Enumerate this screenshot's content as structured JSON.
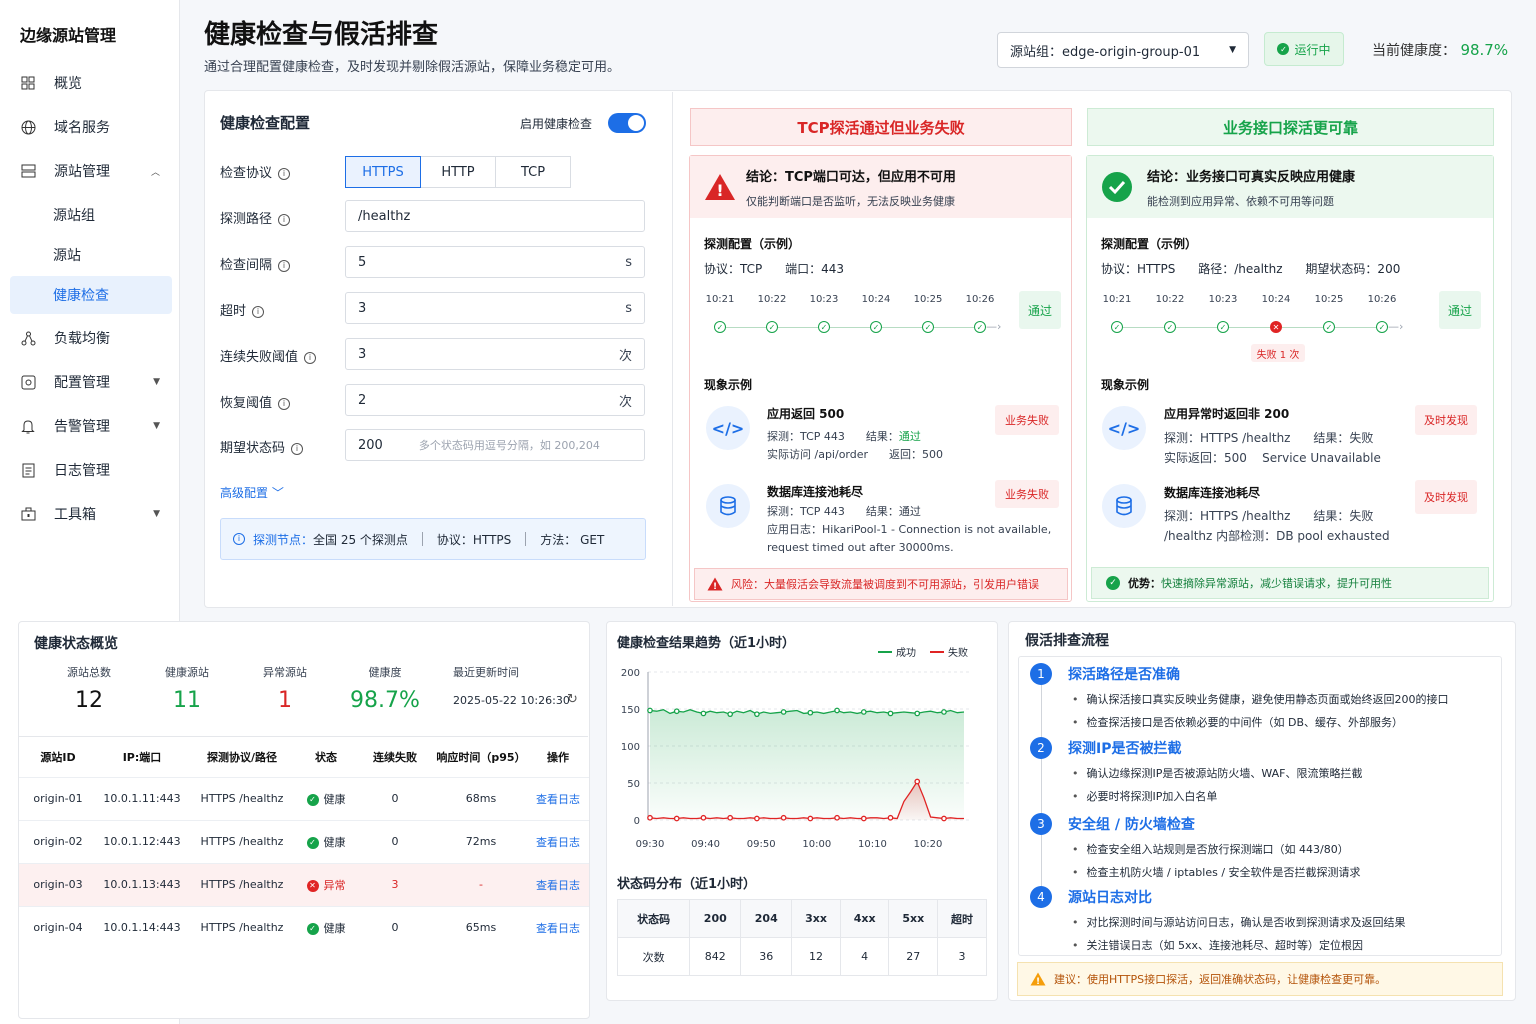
{
  "sidebar": {
    "brand": "边缘源站管理",
    "items": [
      {
        "label": "概览",
        "icon": "grid-icon"
      },
      {
        "label": "域名服务",
        "icon": "globe-icon"
      },
      {
        "label": "源站管理",
        "icon": "server-icon"
      },
      {
        "label": "源站组"
      },
      {
        "label": "源站"
      },
      {
        "label": "健康检查"
      },
      {
        "label": "负载均衡",
        "icon": "share-icon"
      },
      {
        "label": "配置管理",
        "icon": "settings-icon"
      },
      {
        "label": "告警管理",
        "icon": "bell-icon"
      },
      {
        "label": "日志管理",
        "icon": "doc-icon"
      },
      {
        "label": "工具箱",
        "icon": "toolbox-icon"
      }
    ]
  },
  "header": {
    "title": "健康检查与假活排查",
    "subtitle": "通过合理配置健康检查，及时发现并剔除假活源站，保障业务稳定可用。",
    "group_label": "源站组：edge-origin-group-01",
    "status": "运行中",
    "health_label": "当前健康度：",
    "health_value": "98.7%"
  },
  "config": {
    "title": "健康检查配置",
    "enable_label": "启用健康检查",
    "protocol_label": "检查协议",
    "protocols": [
      "HTTPS",
      "HTTP",
      "TCP"
    ],
    "path_label": "探测路径",
    "path": "/healthz",
    "interval_label": "检查间隔",
    "interval": "5",
    "interval_unit": "s",
    "timeout_label": "超时",
    "timeout": "3",
    "timeout_unit": "s",
    "fail_label": "连续失败阈值",
    "fail": "3",
    "fail_unit": "次",
    "recover_label": "恢复阈值",
    "recover": "2",
    "recover_unit": "次",
    "code_label": "期望状态码",
    "code": "200",
    "code_hint": "多个状态码用逗号分隔，如 200,204",
    "advanced": "高级配置",
    "probe_node_label": "探测节点：",
    "probe_nodes": "全国 25 个探测点",
    "probe_proto": "协议：HTTPS",
    "probe_method": "方法：  GET"
  },
  "tcp_card": {
    "title": "TCP探活通过但业务失败",
    "concl": "结论：TCP端口可达，但应用不可用",
    "concl_sub": "仅能判断端口是否监听，无法反映业务健康",
    "probe_title": "探测配置（示例）",
    "probe_line": "协议：TCP      端口：443",
    "times": [
      "10:21",
      "10:22",
      "10:23",
      "10:24",
      "10:25",
      "10:26"
    ],
    "pass": "通过",
    "ex_title": "现象示例",
    "ex1_t": "应用返回 500",
    "ex1_d1a": "探测：TCP 443      结果：",
    "ex1_d1b": "通过",
    "ex1_d2": "实际访问 /api/order      返回：500",
    "ex1_tag": "业务失败",
    "ex2_t": "数据库连接池耗尽",
    "ex2_d1": "探测：TCP 443      结果：通过",
    "ex2_d2": "应用日志：HikariPool-1 - Connection is not available,",
    "ex2_d3": "request timed out after 30000ms.",
    "ex2_tag": "业务失败",
    "risk": "风险：大量假活会导致流量被调度到不可用源站，引发用户错误"
  },
  "http_card": {
    "title": "业务接口探活更可靠",
    "concl": "结论：业务接口可真实反映应用健康",
    "concl_sub": "能检测到应用异常、依赖不可用等问题",
    "probe_title": "探测配置（示例）",
    "probe_line": "协议：HTTPS      路径：/healthz      期望状态码：200",
    "times": [
      "10:21",
      "10:22",
      "10:23",
      "10:24",
      "10:25",
      "10:26"
    ],
    "pass": "通过",
    "fail_tag": "失败 1 次",
    "ex_title": "现象示例",
    "ex1_t": "应用异常时返回非 200",
    "ex1_d1": "探测：HTTPS /healthz      结果：失败",
    "ex1_d2": "实际返回：500    Service Unavailable",
    "ex1_tag": "及时发现",
    "ex2_t": "数据库连接池耗尽",
    "ex2_d1": "探测：HTTPS /healthz      结果：失败",
    "ex2_d2": "/healthz 内部检测：DB pool exhausted",
    "ex2_tag": "及时发现",
    "adv_label": "优势：",
    "adv": "快速摘除异常源站，减少错误请求，提升可用性"
  },
  "overview": {
    "title": "健康状态概览",
    "stats": [
      {
        "label": "源站总数",
        "value": "12",
        "color": "#111111"
      },
      {
        "label": "健康源站",
        "value": "11",
        "color": "#16a34a"
      },
      {
        "label": "异常源站",
        "value": "1",
        "color": "#d92626"
      },
      {
        "label": "健康度",
        "value": "98.7%",
        "color": "#16a34a"
      }
    ],
    "updated_label": "最近更新时间",
    "updated": "2025-05-22 10:26:30",
    "columns": [
      "源站ID",
      "IP:端口",
      "探测协议/路径",
      "状态",
      "连续失败",
      "响应时间（p95）",
      "操作"
    ],
    "rows": [
      {
        "id": "origin-01",
        "ip": "10.0.1.11:443",
        "probe": "HTTPS /healthz",
        "status": "健康",
        "fails": "0",
        "rt": "68ms",
        "op": "查看日志",
        "bad": false
      },
      {
        "id": "origin-02",
        "ip": "10.0.1.12:443",
        "probe": "HTTPS /healthz",
        "status": "健康",
        "fails": "0",
        "rt": "72ms",
        "op": "查看日志",
        "bad": false
      },
      {
        "id": "origin-03",
        "ip": "10.0.1.13:443",
        "probe": "HTTPS /healthz",
        "status": "异常",
        "fails": "3",
        "rt": "-",
        "op": "查看日志",
        "bad": true
      },
      {
        "id": "origin-04",
        "ip": "10.0.1.14:443",
        "probe": "HTTPS /healthz",
        "status": "健康",
        "fails": "0",
        "rt": "65ms",
        "op": "查看日志",
        "bad": false
      }
    ]
  },
  "chart_data": {
    "type": "line",
    "title": "健康检查结果趋势（近1小时）",
    "x": [
      "09:30",
      "09:35",
      "09:40",
      "09:45",
      "09:50",
      "09:55",
      "10:00",
      "10:05",
      "10:10",
      "10:15",
      "10:20",
      "10:25"
    ],
    "x_ticks": [
      "09:30",
      "09:40",
      "09:50",
      "10:00",
      "10:10",
      "10:20"
    ],
    "ylim": [
      0,
      200
    ],
    "yticks": [
      0,
      50,
      100,
      150,
      200
    ],
    "series": [
      {
        "name": "成功",
        "color": "#16a34a",
        "values": [
          148,
          147,
          149,
          144,
          147,
          146,
          149,
          146,
          144,
          147,
          145,
          146,
          143,
          147,
          145,
          148,
          143,
          146,
          144,
          145,
          146,
          147,
          148,
          144,
          145,
          146,
          144,
          146,
          148,
          145,
          146,
          144,
          146,
          147,
          145,
          146,
          144,
          145,
          146,
          145,
          144,
          146,
          147,
          145,
          146,
          148,
          145,
          146
        ]
      },
      {
        "name": "失败",
        "color": "#e02424",
        "values": [
          3,
          2,
          3,
          2,
          2,
          3,
          2,
          2,
          3,
          2,
          3,
          2,
          3,
          2,
          2,
          3,
          2,
          3,
          2,
          2,
          3,
          2,
          2,
          3,
          2,
          3,
          2,
          2,
          3,
          2,
          3,
          2,
          2,
          3,
          3,
          2,
          3,
          2,
          25,
          38,
          52,
          30,
          4,
          3,
          2,
          3,
          2,
          2
        ]
      }
    ]
  },
  "codes": {
    "title": "状态码分布（近1小时）",
    "header": [
      "状态码",
      "200",
      "204",
      "3xx",
      "4xx",
      "5xx",
      "超时"
    ],
    "row": [
      "次数",
      "842",
      "36",
      "12",
      "4",
      "27",
      "3"
    ]
  },
  "flow": {
    "title": "假活排查流程",
    "steps": [
      {
        "n": "1",
        "t": "探活路径是否准确",
        "items": [
          "确认探活接口真实反映业务健康，避免使用静态页面或始终返回200的接口",
          "检查探活接口是否依赖必要的中间件（如 DB、缓存、外部服务）"
        ]
      },
      {
        "n": "2",
        "t": "探测IP是否被拦截",
        "items": [
          "确认边缘探测IP是否被源站防火墙、WAF、限流策略拦截",
          "必要时将探测IP加入白名单"
        ]
      },
      {
        "n": "3",
        "t": "安全组 / 防火墙检查",
        "items": [
          "检查安全组入站规则是否放行探测端口（如 443/80）",
          "检查主机防火墙 / iptables / 安全软件是否拦截探测请求"
        ]
      },
      {
        "n": "4",
        "t": "源站日志对比",
        "items": [
          "对比探测时间与源站访问日志，确认是否收到探测请求及返回结果",
          "关注错误日志（如 5xx、连接池耗尽、超时等）定位根因"
        ]
      }
    ],
    "tip": "建议：使用HTTPS接口探活，返回准确状态码，让健康检查更可靠。"
  }
}
